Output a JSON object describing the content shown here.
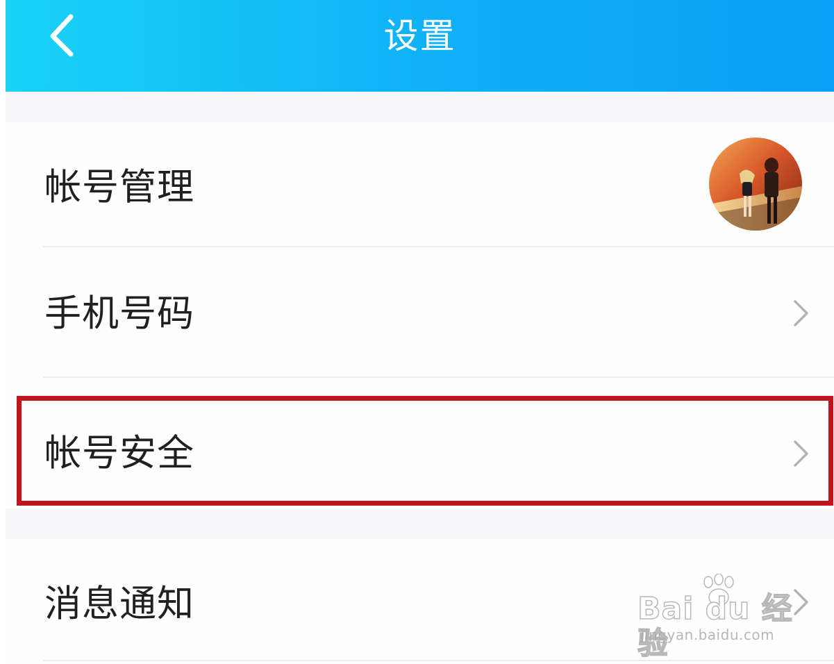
{
  "header": {
    "title": "设置"
  },
  "settings": {
    "items": [
      {
        "label": "帐号管理",
        "trailing": "avatar"
      },
      {
        "label": "手机号码",
        "trailing": "chevron"
      },
      {
        "label": "帐号安全",
        "trailing": "chevron",
        "highlighted": true
      },
      {
        "label": "消息通知",
        "trailing": "chevron"
      }
    ]
  },
  "icons": {
    "back": "chevron-left-icon",
    "chevron": "chevron-right-icon"
  },
  "colors": {
    "header_gradient_start": "#19d2f6",
    "header_gradient_end": "#08a0f6",
    "highlight_border": "#c0161b",
    "label_text": "#202020"
  },
  "watermark": {
    "logo": "Bai du 经验",
    "url": "jingyan.baidu.com"
  }
}
